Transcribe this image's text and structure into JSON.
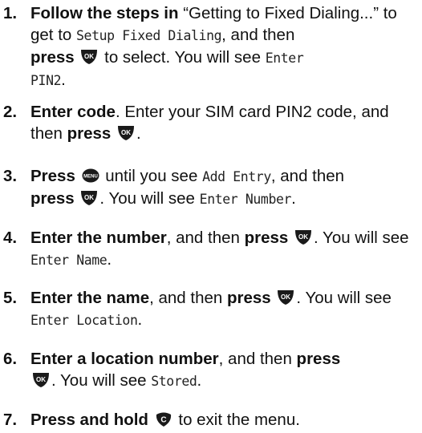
{
  "steps": [
    {
      "num": "1.",
      "bold1": "Follow the steps in",
      "t1": " “Getting to Fixed Dialing...” to get to ",
      "lcd1": "Setup Fixed Dialing",
      "t2": ", and then ",
      "bold2": "press",
      "key": "OK",
      "t3": " to select. You will see ",
      "lcd2a": "Enter",
      "lcd2b": "PIN2",
      "t4": "."
    },
    {
      "num": "2.",
      "bold1": "Enter code",
      "t1": ". Enter your SIM card PIN2 code, and then ",
      "bold2": "press",
      "key": "OK",
      "t2": "."
    },
    {
      "num": "3.",
      "bold1": "Press",
      "key1": "MENU",
      "t1": " until you see ",
      "lcd1": "Add Entry",
      "t2": ", and then ",
      "bold2": "press",
      "key2": "OK",
      "t3": ". You will see ",
      "lcd2": "Enter Number",
      "t4": "."
    },
    {
      "num": "4.",
      "bold1": "Enter the number",
      "t1": ", and then ",
      "bold2": "press",
      "key": "OK",
      "t2": ". You will see ",
      "lcd1": "Enter Name",
      "t3": "."
    },
    {
      "num": "5.",
      "bold1": "Enter the name",
      "t1": ", and then ",
      "bold2": "press",
      "key": "OK",
      "t2": ". You will see ",
      "lcd1": "Enter Location",
      "t3": "."
    },
    {
      "num": "6.",
      "bold1": "Enter a location number",
      "t1": ", and then ",
      "bold2": "press",
      "key": "OK",
      "t2": ". You will see ",
      "lcd1": "Stored",
      "t3": "."
    },
    {
      "num": "7.",
      "bold1": "Press and hold",
      "key": "C",
      "t1": " to exit the menu."
    }
  ]
}
